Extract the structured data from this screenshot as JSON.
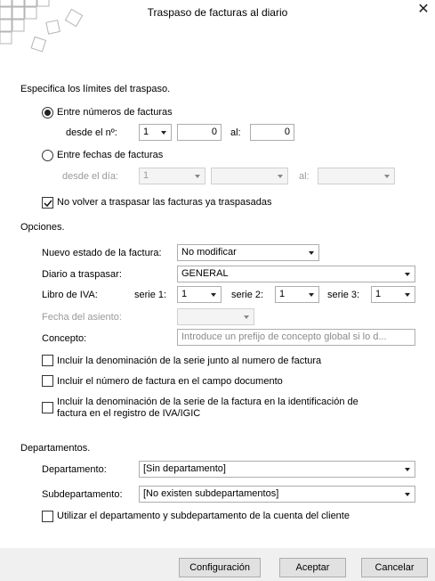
{
  "window": {
    "title": "Traspaso de facturas al diario"
  },
  "limits": {
    "heading": "Especifica los límites del traspaso.",
    "by_number": {
      "option_label": "Entre números de facturas",
      "selected": true,
      "desde_label": "desde el nº:",
      "serie_value": "1",
      "from_value": "0",
      "al_label": "al:",
      "to_value": "0"
    },
    "by_date": {
      "option_label": "Entre fechas de facturas",
      "selected": false,
      "desde_label": "desde el día:",
      "serie_value": "1",
      "from_value": "",
      "al_label": "al:",
      "to_value": ""
    },
    "no_repeat": {
      "label": "No volver a traspasar las facturas ya traspasadas",
      "checked": true
    }
  },
  "options": {
    "heading": "Opciones.",
    "estado": {
      "label": "Nuevo estado de la factura:",
      "value": "No modificar"
    },
    "diario": {
      "label": "Diario a traspasar:",
      "value": "GENERAL"
    },
    "libro_iva": {
      "label": "Libro de IVA:",
      "serie1_label": "serie 1:",
      "serie1_value": "1",
      "serie2_label": "serie 2:",
      "serie2_value": "1",
      "serie3_label": "serie 3:",
      "serie3_value": "1"
    },
    "fecha_asiento": {
      "label": "Fecha del asiento:",
      "value": ""
    },
    "concepto": {
      "label": "Concepto:",
      "placeholder": "Introduce un prefijo de concepto global si lo d..."
    },
    "check_denominacion": {
      "label": "Incluir la denominación de la serie junto al numero de factura",
      "checked": false
    },
    "check_numero_doc": {
      "label": "Incluir el número de factura en el campo documento",
      "checked": false
    },
    "check_registro": {
      "label_line1": "Incluir la denominación de la serie de la factura en la identificación de",
      "label_line2": "factura en el registro de IVA/IGIC",
      "checked": false
    }
  },
  "departments": {
    "heading": "Departamentos.",
    "departamento": {
      "label": "Departamento:",
      "value": "[Sin departamento]"
    },
    "subdepartamento": {
      "label": "Subdepartamento:",
      "value": "[No existen subdepartamentos]"
    },
    "check_cliente": {
      "label": "Utilizar el departamento y subdepartamento de la cuenta del cliente",
      "checked": false
    }
  },
  "buttons": {
    "config": "Configuración",
    "accept": "Aceptar",
    "cancel": "Cancelar"
  },
  "icons": {
    "close": "close-icon",
    "logo": "squares-logo-icon",
    "check": "checkmark-icon",
    "dropdown": "chevron-down-icon"
  }
}
